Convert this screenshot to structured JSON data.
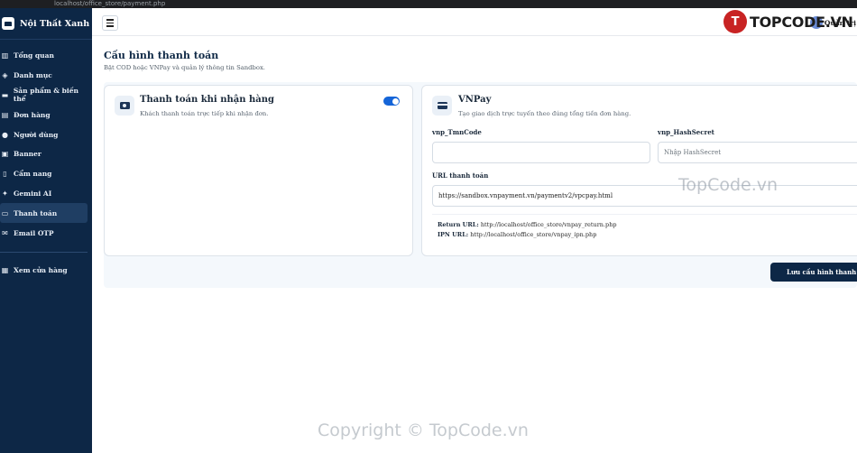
{
  "browser": {
    "url": "localhost/office_store/payment.php"
  },
  "brand": {
    "name": "Nội Thất Xanh"
  },
  "sidebar": {
    "items": [
      {
        "label": "Tổng quan",
        "icon": "chart-icon"
      },
      {
        "label": "Danh mục",
        "icon": "layers-icon"
      },
      {
        "label": "Sản phẩm & biến thể",
        "icon": "couch-icon"
      },
      {
        "label": "Đơn hàng",
        "icon": "bag-icon"
      },
      {
        "label": "Người dùng",
        "icon": "users-icon"
      },
      {
        "label": "Banner",
        "icon": "image-icon"
      },
      {
        "label": "Cẩm nang",
        "icon": "book-icon"
      },
      {
        "label": "Gemini AI",
        "icon": "magic-icon"
      },
      {
        "label": "Thanh toán",
        "icon": "card-icon",
        "active": true
      },
      {
        "label": "Email OTP",
        "icon": "envelope-icon"
      }
    ],
    "store_link": "Xem cửa hàng"
  },
  "topbar": {
    "user": "Quản trị"
  },
  "watermark": {
    "logo_text": "TOPCODE.VN",
    "mid": "TopCode.vn",
    "copyright": "Copyright © TopCode.vn"
  },
  "page": {
    "title": "Cấu hình thanh toán",
    "subtitle": "Bật COD hoặc VNPay và quản lý thông tin Sandbox."
  },
  "cod": {
    "title": "Thanh toán khi nhận hàng",
    "desc": "Khách thanh toán trực tiếp khi nhận đơn.",
    "enabled": true
  },
  "vnpay": {
    "title": "VNPay",
    "desc": "Tạo giao dịch trực tuyến theo đúng tổng tiền đơn hàng.",
    "tmn_label": "vnp_TmnCode",
    "tmn_value": "",
    "secret_label": "vnp_HashSecret",
    "secret_placeholder": "Nhập HashSecret",
    "url_label": "URL thanh toán",
    "url_value": "https://sandbox.vnpayment.vn/paymentv2/vpcpay.html",
    "return_label": "Return URL:",
    "return_value": "http://localhost/office_store/vnpay_return.php",
    "ipn_label": "IPN URL:",
    "ipn_value": "http://localhost/office_store/vnpay_ipn.php"
  },
  "actions": {
    "save_label": "Lưu cấu hình thanh toán"
  },
  "colors": {
    "sidebar": "#0d2746",
    "accent": "#1565d8"
  }
}
